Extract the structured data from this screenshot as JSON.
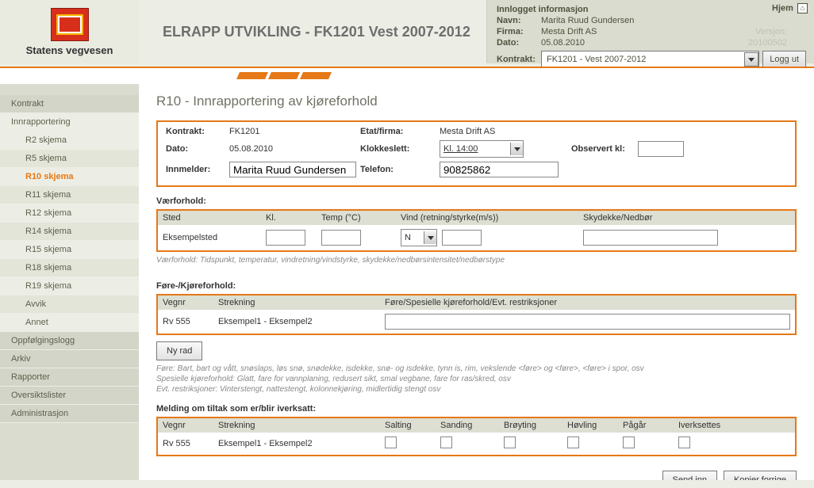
{
  "header": {
    "brand": "Statens vegvesen",
    "title": "ELRAPP UTVIKLING - FK1201 Vest 2007-2012"
  },
  "info_box": {
    "title": "Innlogget informasjon",
    "hjem_label": "Hjem",
    "labels": {
      "navn": "Navn:",
      "firma": "Firma:",
      "dato": "Dato:",
      "kontrakt": "Kontrakt:"
    },
    "navn": "Marita Ruud Gundersen",
    "firma": "Mesta Drift AS",
    "dato": "05.08.2010",
    "versjon_label": "Versjon:",
    "versjon_value": "20100502",
    "kontrakt_selected": "FK1201 - Vest 2007-2012",
    "loggut": "Logg ut"
  },
  "sidebar": {
    "items": [
      {
        "label": "Kontrakt"
      },
      {
        "label": "Innrapportering"
      },
      {
        "label": "R2 skjema"
      },
      {
        "label": "R5 skjema"
      },
      {
        "label": "R10 skjema"
      },
      {
        "label": "R11 skjema"
      },
      {
        "label": "R12 skjema"
      },
      {
        "label": "R14 skjema"
      },
      {
        "label": "R15 skjema"
      },
      {
        "label": "R18 skjema"
      },
      {
        "label": "R19 skjema"
      },
      {
        "label": "Avvik"
      },
      {
        "label": "Annet"
      },
      {
        "label": "Oppfølgingslogg"
      },
      {
        "label": "Arkiv"
      },
      {
        "label": "Rapporter"
      },
      {
        "label": "Oversiktslister"
      },
      {
        "label": "Administrasjon"
      }
    ]
  },
  "page": {
    "title": "R10 - Innrapportering av kjøreforhold",
    "labels": {
      "kontrakt": "Kontrakt:",
      "etat_firma": "Etat/firma:",
      "dato": "Dato:",
      "klokkeslett": "Klokkeslett:",
      "observert": "Observert kl:",
      "innmelder": "Innmelder:",
      "telefon": "Telefon:"
    },
    "kontrakt": "FK1201",
    "etat_firma": "Mesta Drift AS",
    "dato": "05.08.2010",
    "klokkeslett_selected": "Kl. 14:00",
    "observert_kl": "",
    "innmelder": "Marita Ruud Gundersen",
    "telefon": "90825862",
    "weather": {
      "title": "Værforhold:",
      "headers": {
        "sted": "Sted",
        "kl": "Kl.",
        "temp": "Temp (°C)",
        "vind": "Vind (retning/styrke(m/s))",
        "sky": "Skydekke/Nedbør"
      },
      "row": {
        "sted": "Eksempelsted",
        "kl": "",
        "temp": "",
        "vind_dir": "N",
        "vind_styrke": "",
        "sky": ""
      },
      "hint": "Værforhold: Tidspunkt, temperatur, vindretning/vindstyrke, skydekke/nedbørsintensitet/nedbørstype"
    },
    "fore": {
      "title": "Føre-/Kjøreforhold:",
      "headers": {
        "vegnr": "Vegnr",
        "strekning": "Strekning",
        "spes": "Føre/Spesielle kjøreforhold/Evt. restriksjoner"
      },
      "row": {
        "vegnr": "Rv 555",
        "strekning": "Eksempel1 - Eksempel2",
        "spes": ""
      },
      "nyrad": "Ny rad",
      "hints": [
        "Føre: Bart, bart og vått, snøslaps, løs snø, snødekke, isdekke, snø- og isdekke, tynn is, rim, vekslende <føre> og <føre>, <føre> i spor, osv",
        "Spesielle kjøreforhold: Glatt, fare for vannplaning, redusert sikt, smal vegbane, fare for ras/skred, osv",
        "Evt. restriksjoner: Vinterstengt, nattestengt, kolonnekjøring, midlertidig stengt osv"
      ]
    },
    "tiltak": {
      "title": "Melding om tiltak som er/blir iverksatt:",
      "headers": {
        "vegnr": "Vegnr",
        "strekning": "Strekning",
        "salting": "Salting",
        "sanding": "Sanding",
        "broyting": "Brøyting",
        "hovling": "Høvling",
        "pagar": "Pågår",
        "iverksettes": "Iverksettes"
      },
      "row": {
        "vegnr": "Rv 555",
        "strekning": "Eksempel1 - Eksempel2"
      }
    },
    "actions": {
      "send_inn": "Send inn",
      "kopier": "Kopier forrige"
    }
  }
}
